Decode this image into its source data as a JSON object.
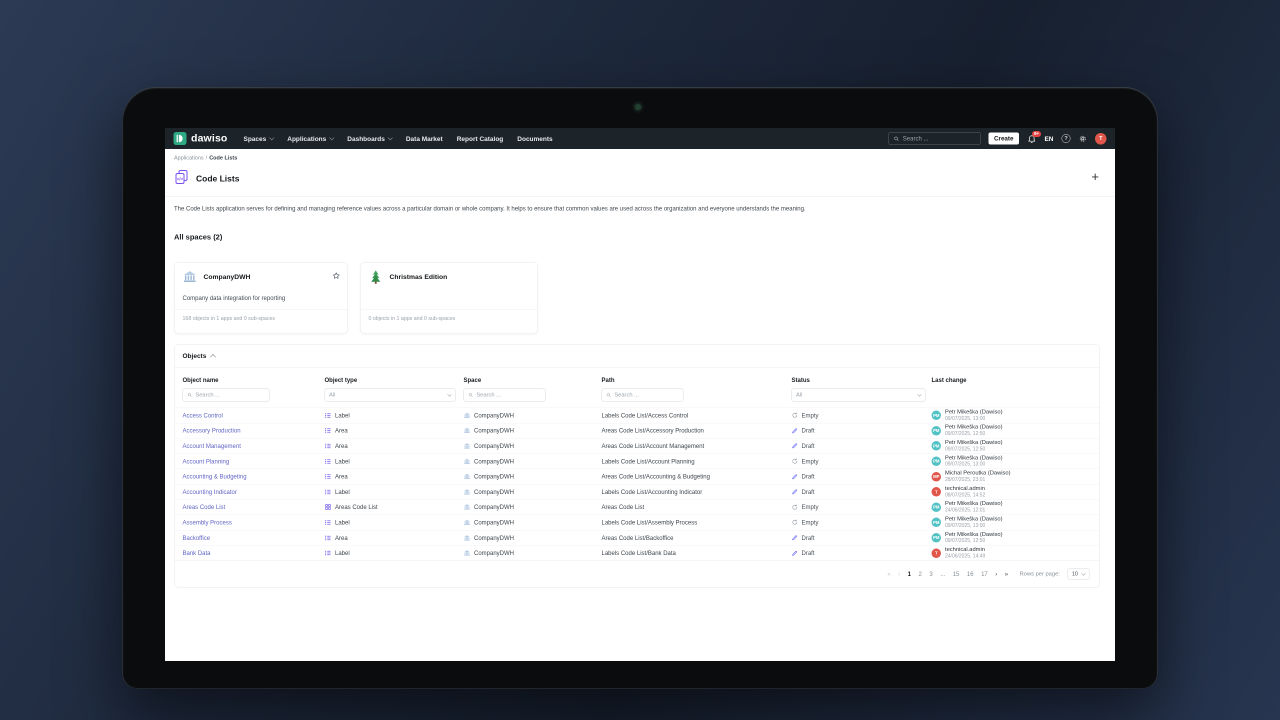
{
  "nav": {
    "brand": "dawiso",
    "menu": [
      {
        "label": "Spaces",
        "chevron": true
      },
      {
        "label": "Applications",
        "chevron": true
      },
      {
        "label": "Dashboards",
        "chevron": true
      },
      {
        "label": "Data Market",
        "chevron": false
      },
      {
        "label": "Report Catalog",
        "chevron": false
      },
      {
        "label": "Documents",
        "chevron": false
      }
    ],
    "search_placeholder": "Search ...",
    "create_label": "Create",
    "notification_badge": "9+",
    "language": "EN",
    "help_glyph": "?",
    "avatar_initial": "T"
  },
  "breadcrumb": {
    "parent": "Applications",
    "separator": "/",
    "current": "Code Lists"
  },
  "page": {
    "title": "Code Lists",
    "add_label": "+",
    "description": "The Code Lists application serves for defining and managing reference values across a particular domain or whole company. It helps to ensure that common values are used across the organization and everyone understands the meaning."
  },
  "spaces": {
    "heading": "All spaces (2)",
    "cards": [
      {
        "name": "CompanyDWH",
        "icon": "bank-icon",
        "description": "Company data integration for reporting",
        "footer": "168 objects in 1 apps and 0 sub-spaces",
        "starred": true
      },
      {
        "name": "Christmas Edition",
        "icon": "christmas-tree-icon",
        "description": "",
        "footer": "0 objects in 1 apps and 0 sub-spaces",
        "starred": false
      }
    ]
  },
  "objects": {
    "title": "Objects",
    "columns": [
      "Object name",
      "Object type",
      "Space",
      "Path",
      "Status",
      "Last change"
    ],
    "filters": {
      "name_placeholder": "Search ...",
      "type_value": "All",
      "space_placeholder": "Search ...",
      "path_placeholder": "Search ...",
      "status_value": "All"
    },
    "rows": [
      {
        "name": "Access Control",
        "type": "Label",
        "type_icon": "list-icon",
        "space": "CompanyDWH",
        "path": "Labels Code List/Access Control",
        "status": "Empty",
        "status_icon": "sync-icon",
        "user": "Petr Mikeška (Dawiso)",
        "time": "09/07/2025, 13:00",
        "avatar": "PM",
        "avatar_color": "#53c2c5"
      },
      {
        "name": "Accessory Production",
        "type": "Area",
        "type_icon": "list-icon",
        "space": "CompanyDWH",
        "path": "Areas Code List/Accessory Production",
        "status": "Draft",
        "status_icon": "pencil-icon",
        "user": "Petr Mikeška (Dawiso)",
        "time": "09/07/2025, 12:50",
        "avatar": "PM",
        "avatar_color": "#53c2c5"
      },
      {
        "name": "Account Management",
        "type": "Area",
        "type_icon": "list-icon",
        "space": "CompanyDWH",
        "path": "Areas Code List/Account Management",
        "status": "Draft",
        "status_icon": "pencil-icon",
        "user": "Petr Mikeška (Dawiso)",
        "time": "09/07/2025, 12:50",
        "avatar": "PM",
        "avatar_color": "#53c2c5"
      },
      {
        "name": "Account Planning",
        "type": "Label",
        "type_icon": "list-icon",
        "space": "CompanyDWH",
        "path": "Labels Code List/Account Planning",
        "status": "Empty",
        "status_icon": "sync-icon",
        "user": "Petr Mikeška (Dawiso)",
        "time": "09/07/2025, 13:00",
        "avatar": "PM",
        "avatar_color": "#53c2c5"
      },
      {
        "name": "Accounting & Budgeting",
        "type": "Area",
        "type_icon": "list-icon",
        "space": "CompanyDWH",
        "path": "Areas Code List/Accounting & Budgeting",
        "status": "Draft",
        "status_icon": "pencil-icon",
        "user": "Michal Peroutka (Dawiso)",
        "time": "28/07/2025, 23:01",
        "avatar": "MP",
        "avatar_color": "#e0564a"
      },
      {
        "name": "Accounting Indicator",
        "type": "Label",
        "type_icon": "list-icon",
        "space": "CompanyDWH",
        "path": "Labels Code List/Accounting Indicator",
        "status": "Draft",
        "status_icon": "pencil-icon",
        "user": "technical.admin",
        "time": "08/07/2025, 14:52",
        "avatar": "T",
        "avatar_color": "#e0564a"
      },
      {
        "name": "Areas Code List",
        "type": "Areas Code List",
        "type_icon": "grid-icon",
        "space": "CompanyDWH",
        "path": "Areas Code List",
        "status": "Empty",
        "status_icon": "sync-icon",
        "user": "Petr Mikeška (Dawiso)",
        "time": "24/06/2025, 12:01",
        "avatar": "PM",
        "avatar_color": "#53c2c5"
      },
      {
        "name": "Assembly Process",
        "type": "Label",
        "type_icon": "list-icon",
        "space": "CompanyDWH",
        "path": "Labels Code List/Assembly Process",
        "status": "Empty",
        "status_icon": "sync-icon",
        "user": "Petr Mikeška (Dawiso)",
        "time": "09/07/2025, 13:00",
        "avatar": "PM",
        "avatar_color": "#53c2c5"
      },
      {
        "name": "Backoffice",
        "type": "Area",
        "type_icon": "list-icon",
        "space": "CompanyDWH",
        "path": "Areas Code List/Backoffice",
        "status": "Draft",
        "status_icon": "pencil-icon",
        "user": "Petr Mikeška (Dawiso)",
        "time": "09/07/2025, 12:50",
        "avatar": "PM",
        "avatar_color": "#53c2c5"
      },
      {
        "name": "Bank Data",
        "type": "Label",
        "type_icon": "list-icon",
        "space": "CompanyDWH",
        "path": "Labels Code List/Bank Data",
        "status": "Draft",
        "status_icon": "pencil-icon",
        "user": "technical.admin",
        "time": "24/06/2025, 14:49",
        "avatar": "T",
        "avatar_color": "#e0564a"
      }
    ],
    "pagination": {
      "items": [
        {
          "label": "«",
          "kind": "arrow-disabled"
        },
        {
          "label": "‹",
          "kind": "arrow-disabled"
        },
        {
          "label": "1",
          "kind": "page-current"
        },
        {
          "label": "2",
          "kind": "page"
        },
        {
          "label": "3",
          "kind": "page"
        },
        {
          "label": "...",
          "kind": "ellipsis"
        },
        {
          "label": "15",
          "kind": "page"
        },
        {
          "label": "16",
          "kind": "page"
        },
        {
          "label": "17",
          "kind": "page"
        },
        {
          "label": "›",
          "kind": "arrow"
        },
        {
          "label": "»",
          "kind": "arrow"
        }
      ],
      "rows_per_page_label": "Rows per page:",
      "rows_per_page": "10"
    }
  },
  "colors": {
    "brand_teal": "#2fa884",
    "link_purple": "#6065c4",
    "icon_purple": "#7c63ea",
    "badge_red": "#e64545",
    "status_draft": "#6366f1",
    "avatar_teal": "#53c2c5",
    "avatar_red": "#e0564a"
  }
}
